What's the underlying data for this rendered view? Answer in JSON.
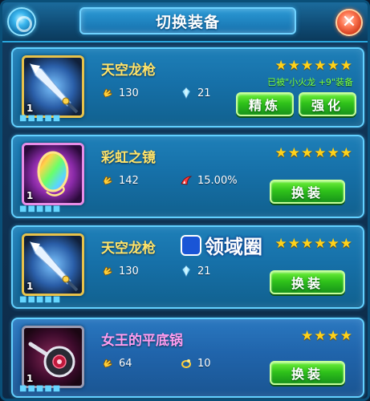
{
  "title": "切换装备",
  "close_glyph": "✕",
  "watermark": "领域圈",
  "card_dots": "■■■■■",
  "colors": {
    "accent_blue": "#1e7fb8",
    "name_gold": "#ffe46a",
    "name_pink": "#ff9df0",
    "star_gold": "#ffd21a",
    "button_green": "#2fc21a",
    "equipped_green": "#7dff47"
  },
  "items": [
    {
      "name": "天空龙枪",
      "stars": "★★★★★★",
      "level": "1",
      "stat1_icon": "gold-hand-icon",
      "stat1": "130",
      "stat2_icon": "blue-gem-icon",
      "stat2": "21",
      "equipped_text": "已被\"小火龙 +9\"装备",
      "btn_refine": "精炼",
      "btn_enhance": "强化"
    },
    {
      "name": "彩虹之镜",
      "stars": "★★★★★★",
      "level": "1",
      "stat1_icon": "gold-hand-icon",
      "stat1": "142",
      "stat2_icon": "red-fang-icon",
      "stat2": "15.00%",
      "btn_equip": "换装"
    },
    {
      "name": "天空龙枪",
      "stars": "★★★★★★",
      "level": "1",
      "stat1_icon": "gold-hand-icon",
      "stat1": "130",
      "stat2_icon": "blue-gem-icon",
      "stat2": "21",
      "btn_equip": "换装"
    },
    {
      "name": "女王的平底锅",
      "stars": "★★★★",
      "level": "1",
      "stat1_icon": "gold-hand-icon",
      "stat1": "64",
      "stat2_icon": "gold-ring-icon",
      "stat2": "10",
      "btn_equip": "换装"
    }
  ]
}
